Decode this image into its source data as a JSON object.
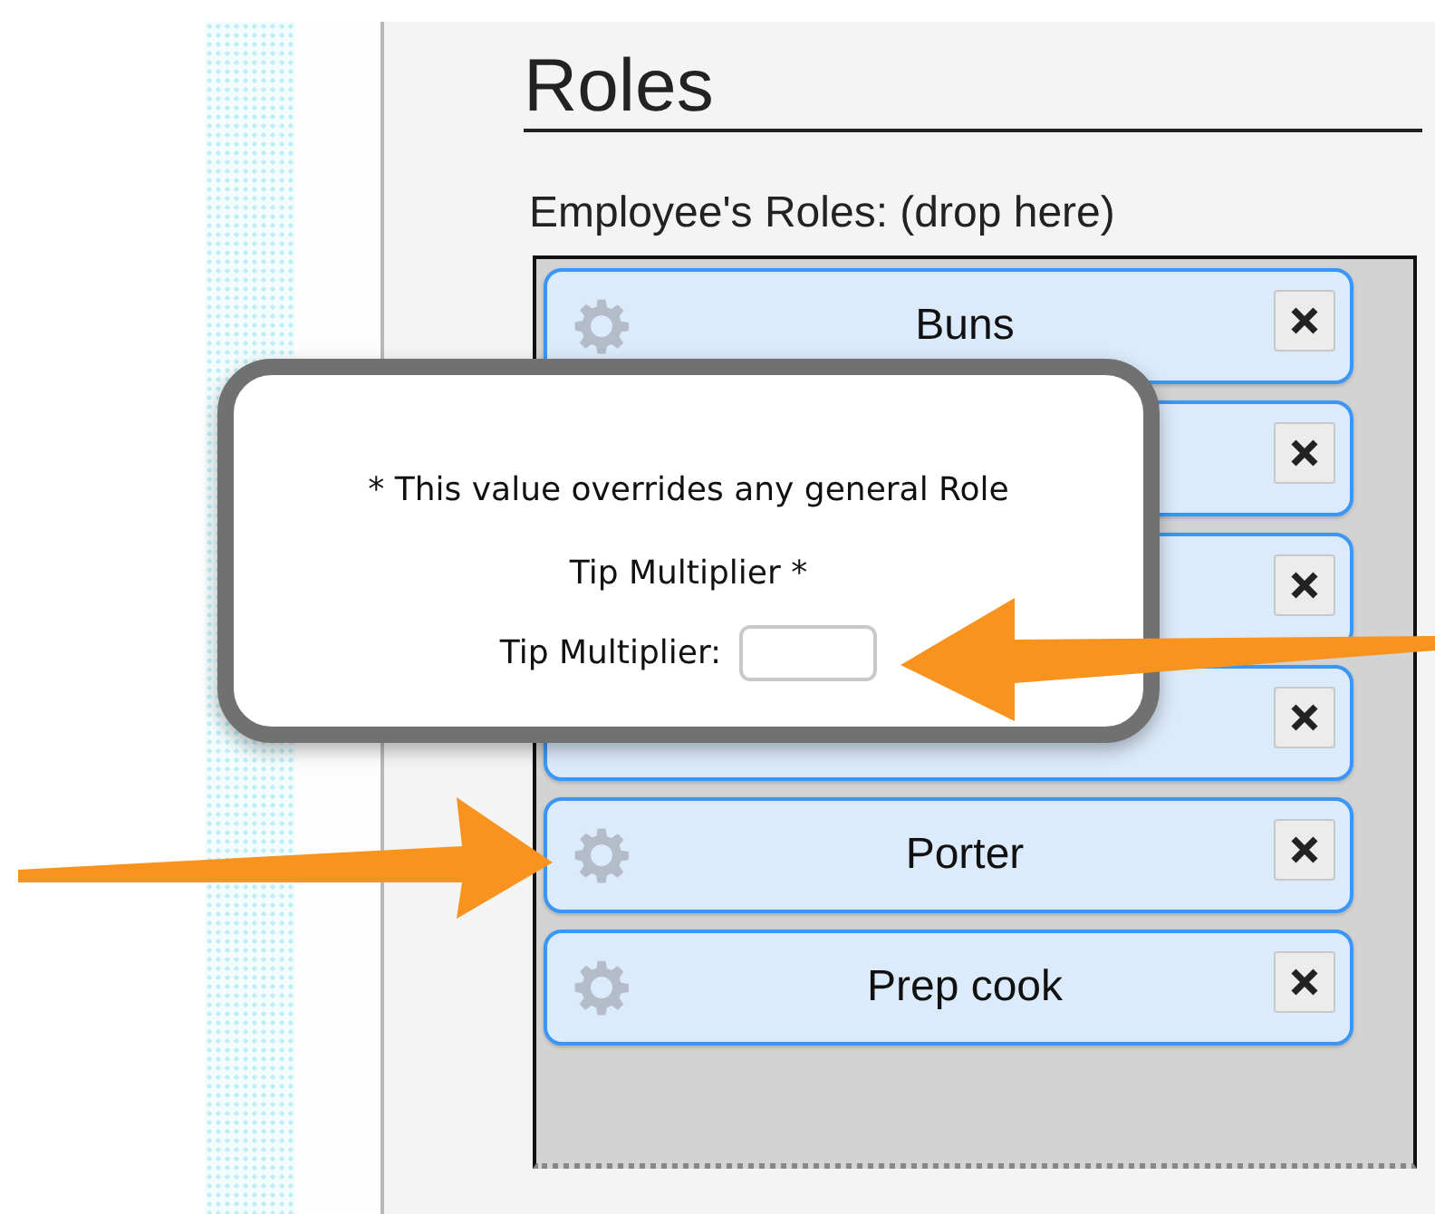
{
  "section": {
    "title": "Roles",
    "drop_label": "Employee's Roles: (drop here)"
  },
  "roles": [
    {
      "kind": "labeled",
      "name": "Buns"
    },
    {
      "kind": "covered"
    },
    {
      "kind": "covered"
    },
    {
      "kind": "covered"
    },
    {
      "kind": "labeled",
      "name": "Porter"
    },
    {
      "kind": "labeled",
      "name": "Prep cook"
    }
  ],
  "popup": {
    "lines": [
      "* This value overrides any general Role",
      "Tip Multiplier *"
    ],
    "field_label": "Tip Multiplier:"
  }
}
